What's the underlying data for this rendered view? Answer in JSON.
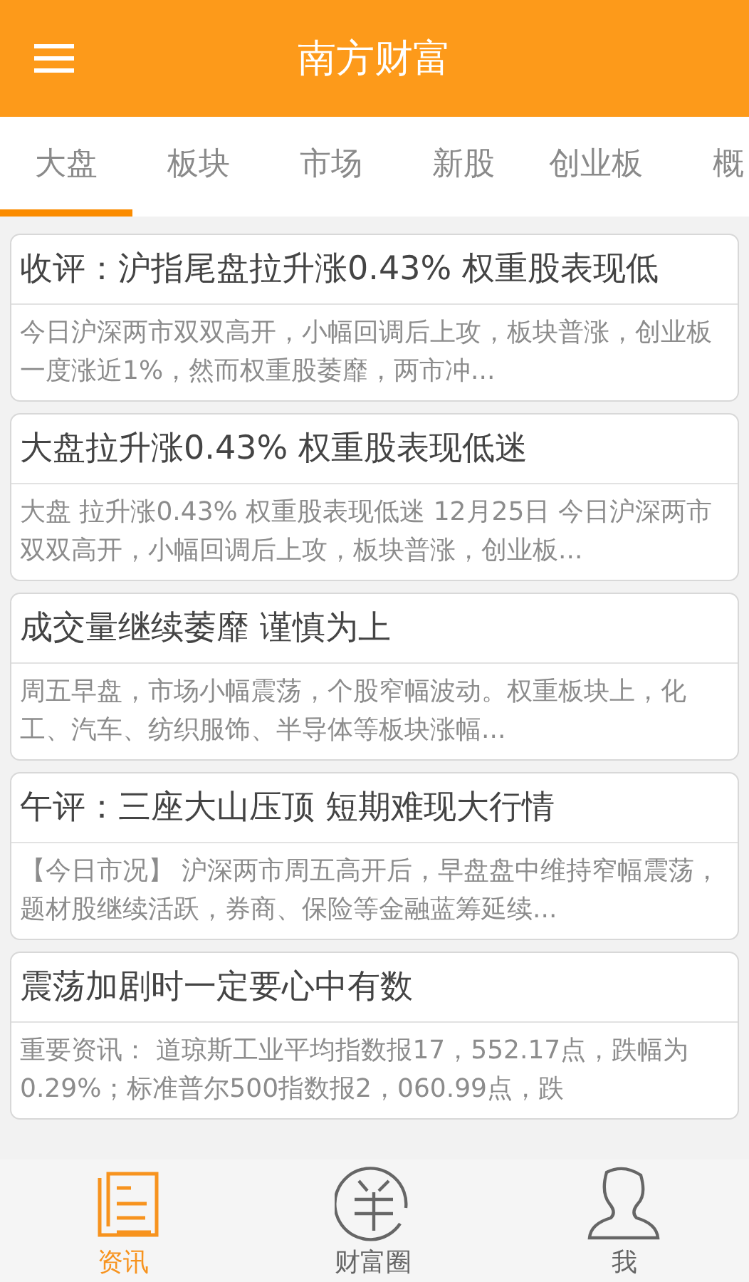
{
  "app_bar": {
    "title": "南方财富"
  },
  "tabs": [
    {
      "label": "大盘",
      "selected": true
    },
    {
      "label": "板块",
      "selected": false
    },
    {
      "label": "市场",
      "selected": false
    },
    {
      "label": "新股",
      "selected": false
    },
    {
      "label": "创业板",
      "selected": false
    },
    {
      "label": "概",
      "selected": false
    }
  ],
  "articles": [
    {
      "title": "收评：沪指尾盘拉升涨0.43% 权重股表现低",
      "summary": "今日沪深两市双双高开，小幅回调后上攻，板块普涨，创业板一度涨近1%，然而权重股萎靡，两市冲..."
    },
    {
      "title": "大盘拉升涨0.43% 权重股表现低迷",
      "summary": "大盘 拉升涨0.43% 权重股表现低迷 12月25日 今日沪深两市双双高开，小幅回调后上攻，板块普涨，创业板..."
    },
    {
      "title": "成交量继续萎靡 谨慎为上",
      "summary": "周五早盘，市场小幅震荡，个股窄幅波动。权重板块上，化工、汽车、纺织服饰、半导体等板块涨幅..."
    },
    {
      "title": "午评：三座大山压顶 短期难现大行情",
      "summary": "【今日市况】 沪深两市周五高开后，早盘盘中维持窄幅震荡，题材股继续活跃，券商、保险等金融蓝筹延续..."
    },
    {
      "title": "震荡加剧时一定要心中有数",
      "summary": "重要资讯： 道琼斯工业平均指数报17，552.17点，跌幅为0.29%；标准普尔500指数报2，060.99点，跌"
    }
  ],
  "bottom_nav": [
    {
      "label": "资讯",
      "kind": "news",
      "selected": true
    },
    {
      "label": "财富圈",
      "kind": "coin",
      "selected": false
    },
    {
      "label": "我",
      "kind": "profile",
      "selected": false
    }
  ]
}
